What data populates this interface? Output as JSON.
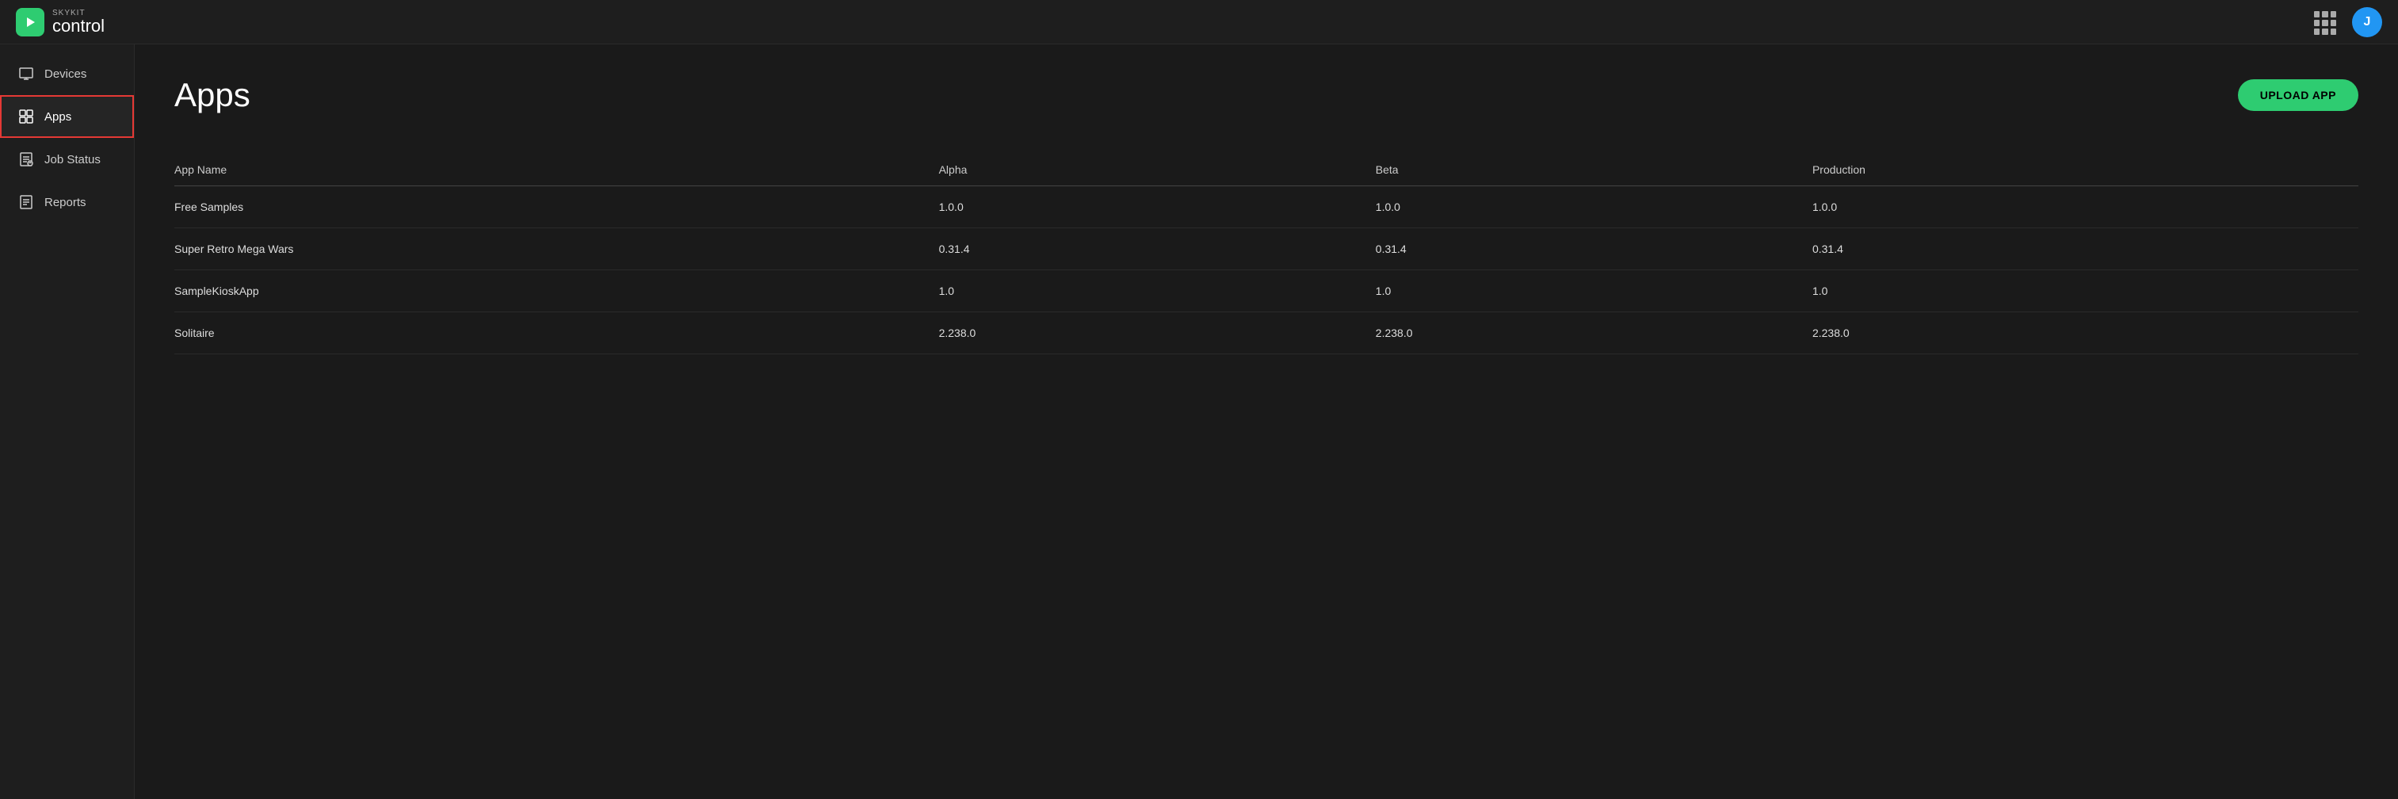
{
  "header": {
    "brand": "SKYKIT",
    "product": "control",
    "grid_icon_label": "apps-grid",
    "user_initial": "J"
  },
  "sidebar": {
    "items": [
      {
        "id": "devices",
        "label": "Devices",
        "icon": "device-icon",
        "active": false
      },
      {
        "id": "apps",
        "label": "Apps",
        "icon": "apps-icon",
        "active": true
      },
      {
        "id": "job-status",
        "label": "Job Status",
        "icon": "job-status-icon",
        "active": false
      },
      {
        "id": "reports",
        "label": "Reports",
        "icon": "reports-icon",
        "active": false
      }
    ]
  },
  "main": {
    "page_title": "Apps",
    "upload_button_label": "UPLOAD APP",
    "table": {
      "columns": [
        {
          "id": "name",
          "label": "App Name"
        },
        {
          "id": "alpha",
          "label": "Alpha"
        },
        {
          "id": "beta",
          "label": "Beta"
        },
        {
          "id": "production",
          "label": "Production"
        }
      ],
      "rows": [
        {
          "name": "Free Samples",
          "alpha": "1.0.0",
          "beta": "1.0.0",
          "production": "1.0.0"
        },
        {
          "name": "Super Retro Mega Wars",
          "alpha": "0.31.4",
          "beta": "0.31.4",
          "production": "0.31.4"
        },
        {
          "name": "SampleKioskApp",
          "alpha": "1.0",
          "beta": "1.0",
          "production": "1.0"
        },
        {
          "name": "Solitaire",
          "alpha": "2.238.0",
          "beta": "2.238.0",
          "production": "2.238.0"
        }
      ]
    }
  }
}
